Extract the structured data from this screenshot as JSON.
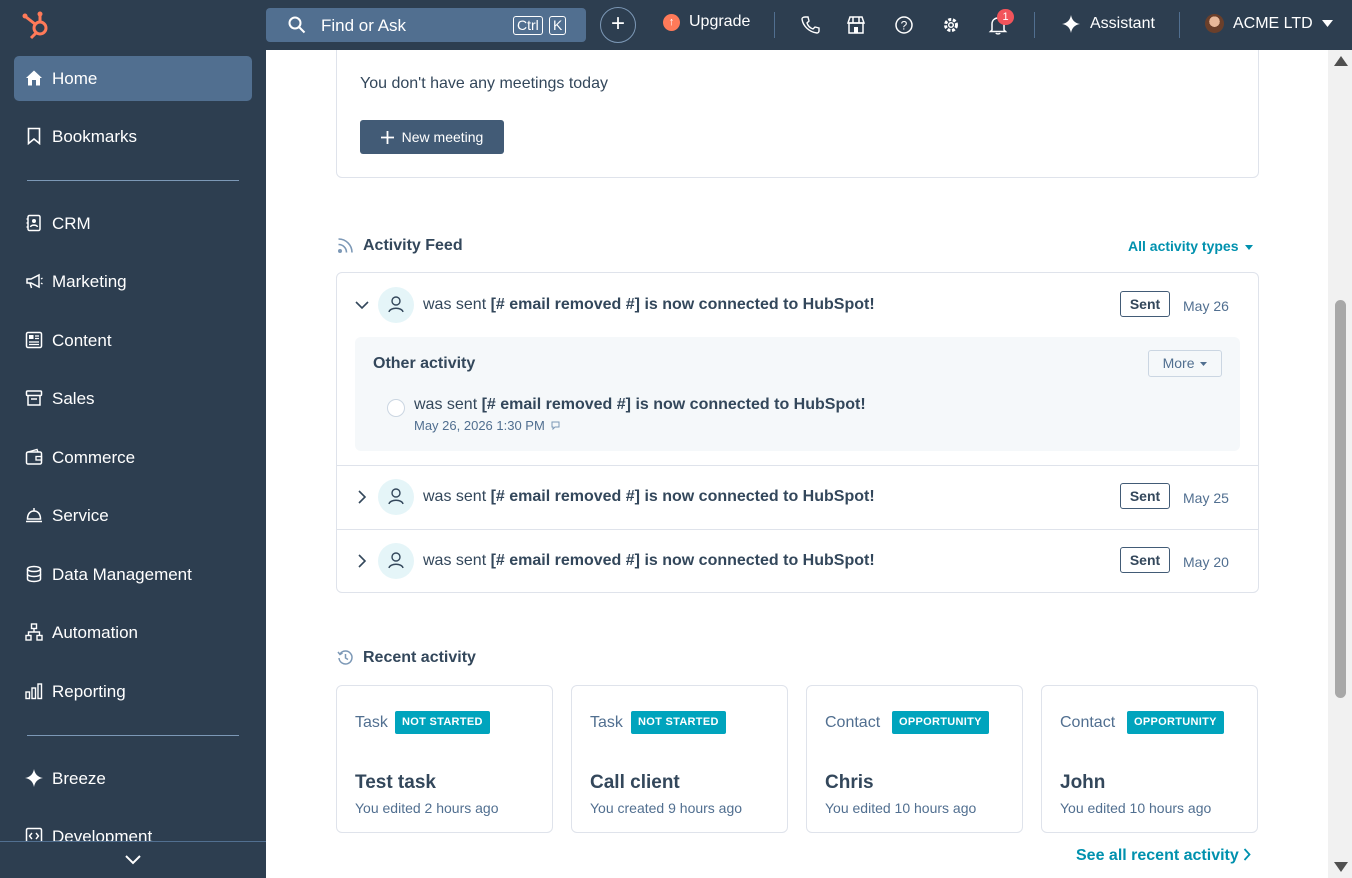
{
  "topbar": {
    "search_placeholder": "Find or Ask",
    "shortcut_ctrl": "Ctrl",
    "shortcut_key": "K",
    "plus_label": "+",
    "upgrade_label": "Upgrade",
    "notification_count": "1",
    "assistant_label": "Assistant",
    "account_name": "ACME LTD"
  },
  "sidebar": {
    "items": [
      {
        "label": "Home",
        "icon": "home-icon"
      },
      {
        "label": "Bookmarks",
        "icon": "bookmark-icon"
      },
      {
        "label": "CRM",
        "icon": "contacts-icon"
      },
      {
        "label": "Marketing",
        "icon": "megaphone-icon"
      },
      {
        "label": "Content",
        "icon": "content-icon"
      },
      {
        "label": "Sales",
        "icon": "sales-icon"
      },
      {
        "label": "Commerce",
        "icon": "wallet-icon"
      },
      {
        "label": "Service",
        "icon": "bell-service-icon"
      },
      {
        "label": "Data Management",
        "icon": "database-icon"
      },
      {
        "label": "Automation",
        "icon": "workflow-icon"
      },
      {
        "label": "Reporting",
        "icon": "bar-chart-icon"
      },
      {
        "label": "Breeze",
        "icon": "sparkle-icon"
      },
      {
        "label": "Development",
        "icon": "code-icon"
      }
    ]
  },
  "meetings": {
    "empty_text": "You don't have any meetings today",
    "new_meeting_label": "New meeting"
  },
  "activity_feed": {
    "title": "Activity Feed",
    "filter_label": "All activity types",
    "rows": [
      {
        "prefix": "was sent ",
        "subject": "[# email removed #] is now connected to HubSpot!",
        "tag": "Sent",
        "date": "May 26"
      },
      {
        "prefix": "was sent ",
        "subject": "[# email removed #] is now connected to HubSpot!",
        "tag": "Sent",
        "date": "May 25"
      },
      {
        "prefix": "was sent ",
        "subject": "[# email removed #] is now connected to HubSpot!",
        "tag": "Sent",
        "date": "May 20"
      }
    ],
    "other_activity": {
      "title": "Other activity",
      "more_label": "More",
      "prefix": "was sent ",
      "subject": "[# email removed #] is now connected to HubSpot!",
      "timestamp": "May 26, 2026 1:30 PM"
    }
  },
  "recent_activity": {
    "title": "Recent activity",
    "cards": [
      {
        "type": "Task",
        "badge": "NOT STARTED",
        "name": "Test task",
        "sub": "You edited 2 hours ago"
      },
      {
        "type": "Task",
        "badge": "NOT STARTED",
        "name": "Call client",
        "sub": "You created 9 hours ago"
      },
      {
        "type": "Contact",
        "badge": "OPPORTUNITY",
        "name": "Chris",
        "sub": "You edited 10 hours ago"
      },
      {
        "type": "Contact",
        "badge": "OPPORTUNITY",
        "name": "John",
        "sub": "You edited 10 hours ago"
      }
    ],
    "see_all_label": "See all recent activity"
  },
  "colors": {
    "nav_bg": "#2d3e50",
    "nav_active": "#516f90",
    "accent_teal": "#00a4bd",
    "link": "#0091ae",
    "upgrade_orange": "#ff7a59",
    "badge_red": "#f2545b"
  }
}
